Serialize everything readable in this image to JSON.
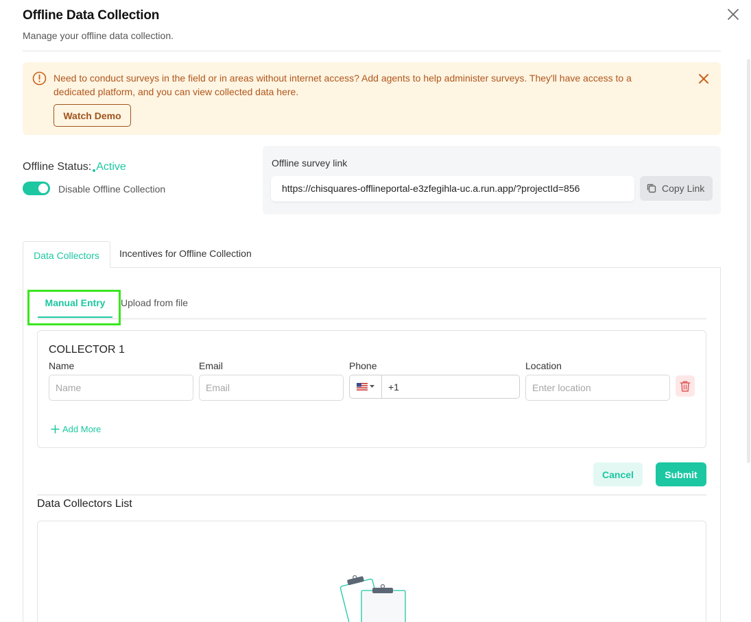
{
  "modal": {
    "title": "Offline Data Collection",
    "subtitle": "Manage your offline data collection."
  },
  "banner": {
    "message": "Need to conduct surveys in the field or in areas without internet access? Add agents to help administer surveys. They'll have access to a dedicated platform, and you can view collected data here.",
    "button_label": "Watch Demo"
  },
  "status": {
    "label": "Offline Status:",
    "value": "Active",
    "toggle_label": "Disable Offline Collection",
    "toggle_on": true
  },
  "survey_link": {
    "title": "Offline survey link",
    "url": "https://chisquares-offlineportal-e3zfegihla-uc.a.run.app/?projectId=856",
    "copy_label": "Copy Link"
  },
  "tabs": [
    {
      "label": "Data Collectors",
      "active": true
    },
    {
      "label": "Incentives for Offline Collection",
      "active": false
    }
  ],
  "subtabs": [
    {
      "label": "Manual Entry",
      "active": true
    },
    {
      "label": "Upload from file",
      "active": false
    }
  ],
  "collector": {
    "title": "COLLECTOR 1",
    "name_label": "Name",
    "name_placeholder": "Name",
    "email_label": "Email",
    "email_placeholder": "Email",
    "phone_label": "Phone",
    "phone_value": "+1",
    "location_label": "Location",
    "location_placeholder": "Enter location",
    "add_more_label": "Add More"
  },
  "actions": {
    "cancel_label": "Cancel",
    "submit_label": "Submit"
  },
  "list": {
    "title": "Data Collectors List"
  },
  "colors": {
    "accent": "#1cc7a2",
    "banner_bg": "#fef5e3",
    "banner_text": "#b0561b",
    "highlight": "#39e61e",
    "danger": "#e05a5a"
  },
  "icons": [
    "close-icon",
    "info-icon",
    "copy-icon",
    "us-flag-icon",
    "trash-icon",
    "plus-icon",
    "clipboard-icon"
  ]
}
